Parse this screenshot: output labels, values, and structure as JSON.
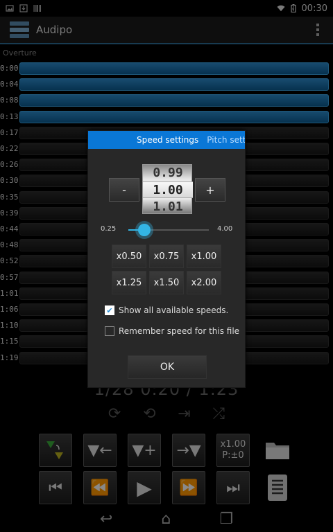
{
  "status_bar": {
    "time": "00:30",
    "icons": [
      "image-icon",
      "download-icon",
      "barcode-icon",
      "wifi-icon",
      "battery-icon"
    ]
  },
  "app": {
    "title": "Audipo"
  },
  "marks": {
    "section_label": "Overture",
    "times": [
      "0:00",
      "0:04",
      "0:08",
      "0:13",
      "0:17",
      "0:22",
      "0:26",
      "0:30",
      "0:35",
      "0:39",
      "0:44",
      "0:48",
      "0:52",
      "0:57",
      "1:01",
      "1:06",
      "1:10",
      "1:15",
      "1:19"
    ],
    "played_count": 4
  },
  "player": {
    "time_display": "1/28   0:20 / 1:23",
    "ab_label": "x1.00",
    "pitch_label": "P:±0",
    "controls": [
      "marker-jump-icon",
      "add-mark-back-icon",
      "add-mark-icon",
      "next-mark-icon",
      "speed-pitch-button",
      "folder-icon",
      "skip-back-icon",
      "rewind-icon",
      "play-icon",
      "fast-forward-icon",
      "skip-forward-icon",
      "playlist-icon"
    ]
  },
  "dialog": {
    "tabs": [
      "Speed settings",
      "Pitch setti"
    ],
    "minus_label": "-",
    "plus_label": "+",
    "picker": {
      "prev": "0.99",
      "current": "1.00",
      "next": "1.01"
    },
    "slider": {
      "min_label": "0.25",
      "max_label": "4.00",
      "value": 1.0,
      "min": 0.25,
      "max": 4.0
    },
    "presets": [
      "x0.50",
      "x0.75",
      "x1.00",
      "x1.25",
      "x1.50",
      "x2.00"
    ],
    "show_all_label": "Show all available speeds.",
    "show_all_checked": true,
    "remember_label": "Remember speed for this file",
    "remember_checked": false,
    "ok_label": "OK"
  },
  "colors": {
    "accent": "#0a77d6",
    "played_bar": "#2b89c9",
    "slider": "#33b5e5"
  }
}
